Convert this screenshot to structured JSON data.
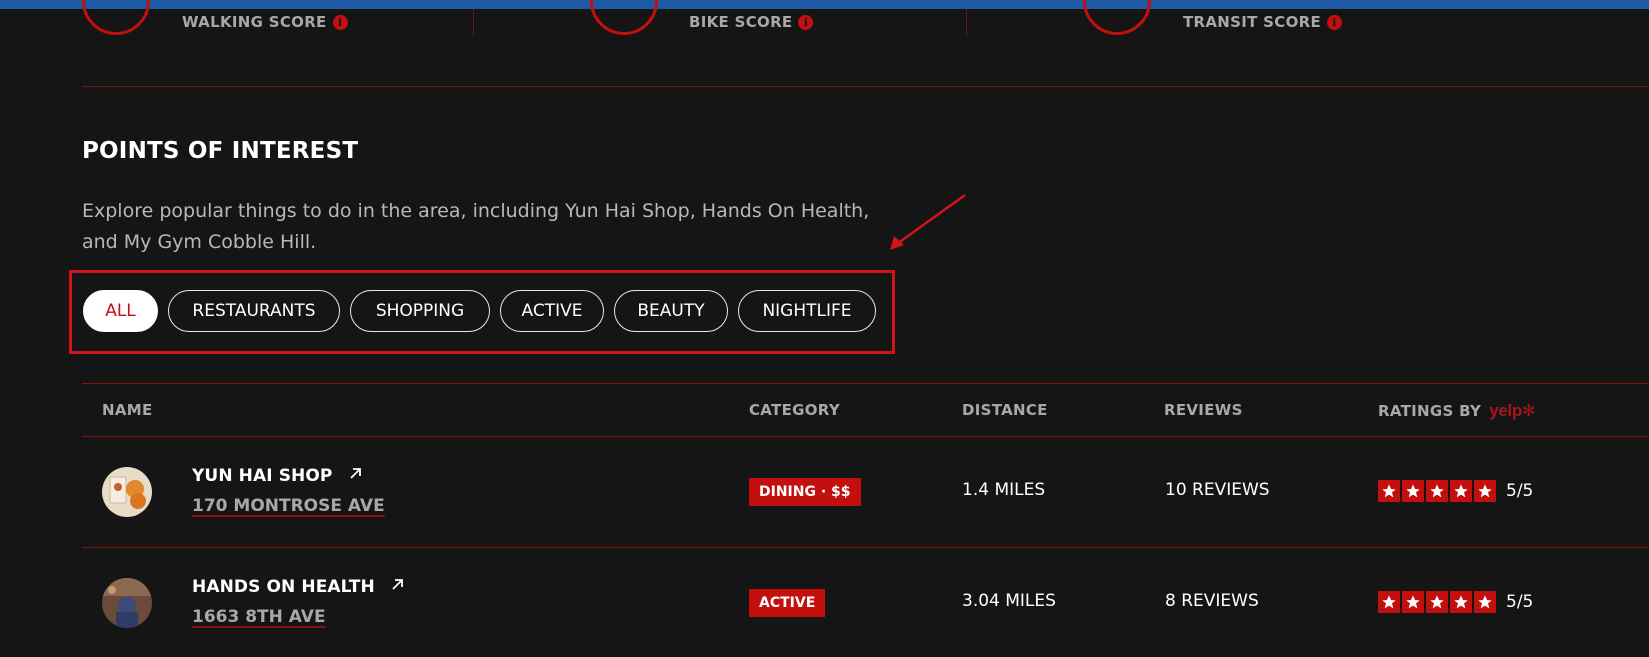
{
  "scores": [
    {
      "label": "WALKING SCORE",
      "icon": "info-icon"
    },
    {
      "label": "BIKE SCORE",
      "icon": "info-icon"
    },
    {
      "label": "TRANSIT SCORE",
      "icon": "info-icon"
    }
  ],
  "poi": {
    "title": "POINTS OF INTEREST",
    "description": "Explore popular things to do in the area, including Yun Hai Shop, Hands On Health, and My Gym Cobble Hill."
  },
  "filters": [
    {
      "label": "ALL",
      "active": true
    },
    {
      "label": "RESTAURANTS",
      "active": false
    },
    {
      "label": "SHOPPING",
      "active": false
    },
    {
      "label": "ACTIVE",
      "active": false
    },
    {
      "label": "BEAUTY",
      "active": false
    },
    {
      "label": "NIGHTLIFE",
      "active": false
    }
  ],
  "table": {
    "headers": {
      "name": "NAME",
      "category": "CATEGORY",
      "distance": "DISTANCE",
      "reviews": "REVIEWS",
      "ratings": "RATINGS BY",
      "ratings_brand": "yelp"
    },
    "rows": [
      {
        "name": "YUN HAI SHOP",
        "address": "170 MONTROSE AVE",
        "category": "DINING · $$",
        "distance": "1.4 MILES",
        "reviews": "10 REVIEWS",
        "stars": 5,
        "rating": "5/5"
      },
      {
        "name": "HANDS ON HEALTH",
        "address": "1663 8TH AVE",
        "category": "ACTIVE",
        "distance": "3.04 MILES",
        "reviews": "8 REVIEWS",
        "stars": 5,
        "rating": "5/5"
      }
    ]
  },
  "colors": {
    "accent": "#c40f0f",
    "background": "#151515",
    "topbar": "#1f5aa6"
  }
}
